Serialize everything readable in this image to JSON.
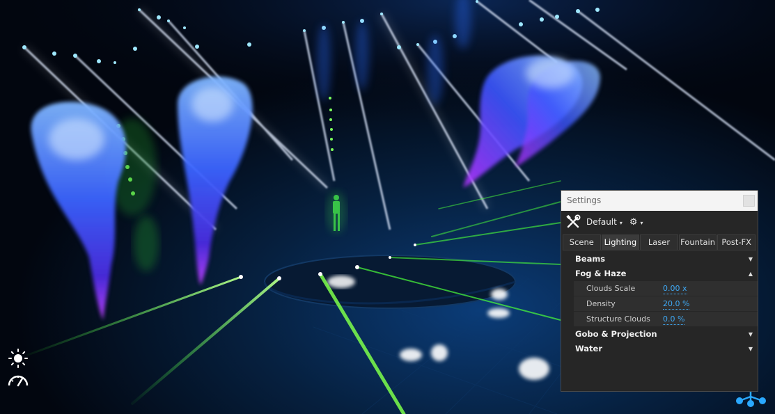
{
  "window": {
    "title": "Settings"
  },
  "toolbar": {
    "tools_icon": "tools-icon",
    "preset_label": "Default",
    "preset_caret": "▾",
    "gear_icon": "gear-icon",
    "gear_caret": "▾"
  },
  "tabs": [
    {
      "label": "Scene",
      "active": false
    },
    {
      "label": "Lighting",
      "active": true
    },
    {
      "label": "Laser",
      "active": false
    },
    {
      "label": "Fountain",
      "active": false
    },
    {
      "label": "Post-FX",
      "active": false
    }
  ],
  "groups": {
    "beams": {
      "label": "Beams",
      "expanded": false
    },
    "fog": {
      "label": "Fog & Haze",
      "expanded": true,
      "properties": [
        {
          "name": "Clouds Scale",
          "value": "0.00 x"
        },
        {
          "name": "Density",
          "value": "20.0 %"
        },
        {
          "name": "Structure Clouds",
          "value": "0.0 %"
        }
      ]
    },
    "gobo": {
      "label": "Gobo & Projection",
      "expanded": false
    },
    "water": {
      "label": "Water",
      "expanded": false
    }
  },
  "hud": {
    "brightness_icon": "sun-icon",
    "performance_icon": "speedometer-icon",
    "network_icon": "network-nodes-icon"
  },
  "colors": {
    "accent_value": "#3fa9f5",
    "panel_bg": "#262626",
    "beam_green": "#39ff3a",
    "smoke_blue": "#2a55ff",
    "smoke_violet": "#b030ff"
  }
}
